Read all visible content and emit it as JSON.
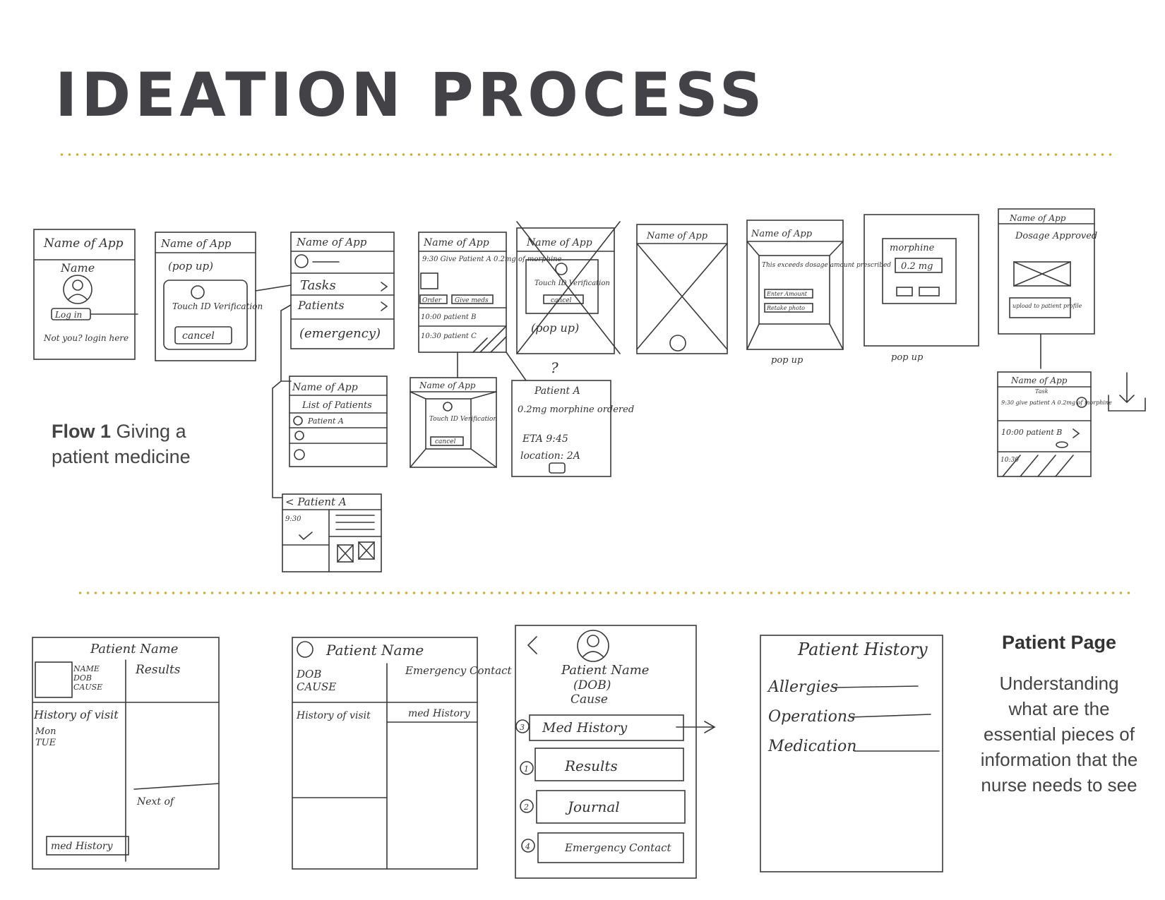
{
  "page": {
    "title": "IDEATION PROCESS",
    "accent_color": "#c9b038",
    "title_color": "#434246"
  },
  "flow1": {
    "label_bold": "Flow 1",
    "label_rest": "Giving a patient medicine"
  },
  "patient_page": {
    "heading": "Patient Page",
    "description": "Understanding what are the essential pieces of information that the nurse needs to see"
  },
  "sketch_text": {
    "name_of_app": "Name of App",
    "name": "Name",
    "log_in": "Log in",
    "not_you": "Not you? login here",
    "pop_up_paren": "(pop up)",
    "touch_id": "Touch ID Verification",
    "cancel": "cancel",
    "tasks": "Tasks",
    "patients": "Patients",
    "emergency": "(emergency)",
    "give_patient": "9:30 Give Patient A 0.2mg of morphine",
    "order": "Order",
    "give_meds": "Give meds",
    "patient_b": "10:00 patient B",
    "patient_c": "10:30 patient C",
    "list_of_patients": "List of Patients",
    "patient_a": "Patient A",
    "back_patient_a": "< Patient A",
    "time_930": "9:30",
    "question": "?",
    "patient_a_card": "Patient A",
    "morphine_ordered": "0.2mg morphine ordered",
    "eta": "ETA 9:45",
    "location": "location: 2A",
    "exceeds": "This exceeds dosage amount prescribed",
    "enter_amount": "Enter Amount",
    "retake_photo": "Retake photo",
    "pop_up": "pop up",
    "morphine": "morphine",
    "dose": "0.2 mg",
    "dosage_approved": "Dosage Approved",
    "upload_profile": "upload to patient profile",
    "task": "Task",
    "task_desc": "9:30 give patient A 0.2mg of morphine",
    "patient_b_short": "10:00 patient B",
    "time_1030": "10:30",
    "patient_name": "Patient Name",
    "name_dob_cause": [
      "NAME",
      "DOB",
      "CAUSE"
    ],
    "results": "Results",
    "history_of_visit": "History of visit",
    "mon": "Mon",
    "tue": "TUE",
    "next_of": "Next of",
    "med_history": "med History",
    "dob": "DOB",
    "cause": "CAUSE",
    "emergency_contact": "Emergency Contact",
    "history_of_visit_2": "History of visit",
    "dob_paren": "(DOB)",
    "cause_word": "Cause",
    "med_history_btn": "Med History",
    "results_btn": "Results",
    "journal_btn": "Journal",
    "emergency_contact_btn": "Emergency Contact",
    "num_3": "3",
    "num_1": "1",
    "num_2": "2",
    "num_4": "4",
    "patient_history": "Patient History",
    "allergies": "Allergies",
    "operations": "Operations",
    "medication": "Medication"
  }
}
